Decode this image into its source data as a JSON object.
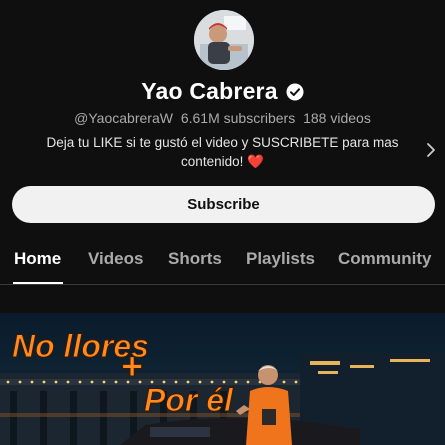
{
  "channel": {
    "name": "Yao Cabrera",
    "handle": "@YaocabreraW",
    "subscribers": "6.61M subscribers",
    "videos": "188 videos",
    "description_text": "Deja tu  LIKE si te gustó el video y SUSCRIBETE para mas contenido!",
    "description_emoji": "❤️",
    "subscribe_label": "Subscribe"
  },
  "tabs": [
    {
      "label": "Home",
      "active": true
    },
    {
      "label": "Videos",
      "active": false
    },
    {
      "label": "Shorts",
      "active": false
    },
    {
      "label": "Playlists",
      "active": false
    },
    {
      "label": "Community",
      "active": false
    }
  ],
  "featured": {
    "line1": "No llores",
    "line2": "Por él",
    "plus": "+"
  },
  "colors": {
    "background": "#0f0f0f",
    "subscribe_bg": "#f1f1f1",
    "title_orange": "#ff8a1e",
    "heart_red": "#e53935"
  },
  "icons": {
    "verified": "verified-check-icon",
    "chevron": "chevron-right-icon"
  }
}
